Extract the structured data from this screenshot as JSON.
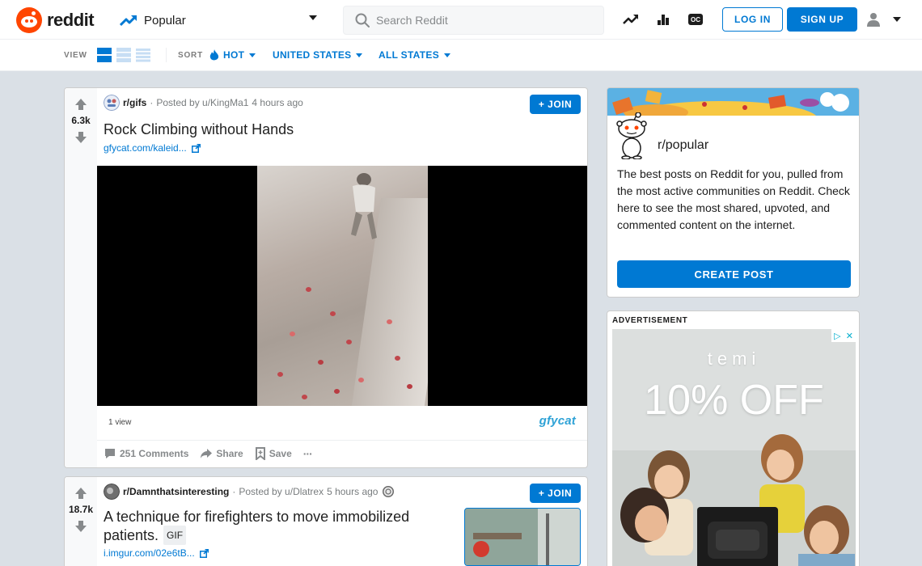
{
  "header": {
    "logo_text": "reddit",
    "feed_label": "Popular",
    "search_placeholder": "Search Reddit",
    "login_label": "LOG IN",
    "signup_label": "SIGN UP",
    "oc_label": "OC"
  },
  "subbar": {
    "view_label": "VIEW",
    "sort_label": "SORT",
    "sort_value": "HOT",
    "region_value": "UNITED STATES",
    "state_value": "ALL STATES"
  },
  "posts": [
    {
      "score": "6.3k",
      "subreddit": "r/gifs",
      "posted_by": "Posted by u/KingMa1",
      "time": "4 hours ago",
      "join_label": "+ JOIN",
      "title": "Rock Climbing without Hands",
      "link": "gfycat.com/kaleid...",
      "views": "1 view",
      "embed_brand": "gfycat",
      "comments": "251 Comments",
      "share": "Share",
      "save": "Save",
      "more": "···"
    },
    {
      "score": "18.7k",
      "subreddit": "r/Damnthatsinteresting",
      "posted_by": "Posted by u/Dlatrex",
      "time": "5 hours ago",
      "join_label": "+ JOIN",
      "title": "A technique for firefighters to move immobilized patients.",
      "flair": "GIF",
      "link": "i.imgur.com/02e6tB..."
    }
  ],
  "sidebar": {
    "name": "r/popular",
    "description": "The best posts on Reddit for you, pulled from the most active communities on Reddit. Check here to see the most shared, upvoted, and commented content on the internet.",
    "create_label": "CREATE POST"
  },
  "ad": {
    "label": "ADVERTISEMENT",
    "brand": "temi",
    "offer": "10% OFF"
  },
  "colors": {
    "brand": "#ff4500",
    "accent": "#0079d3",
    "background": "#dae0e6"
  }
}
